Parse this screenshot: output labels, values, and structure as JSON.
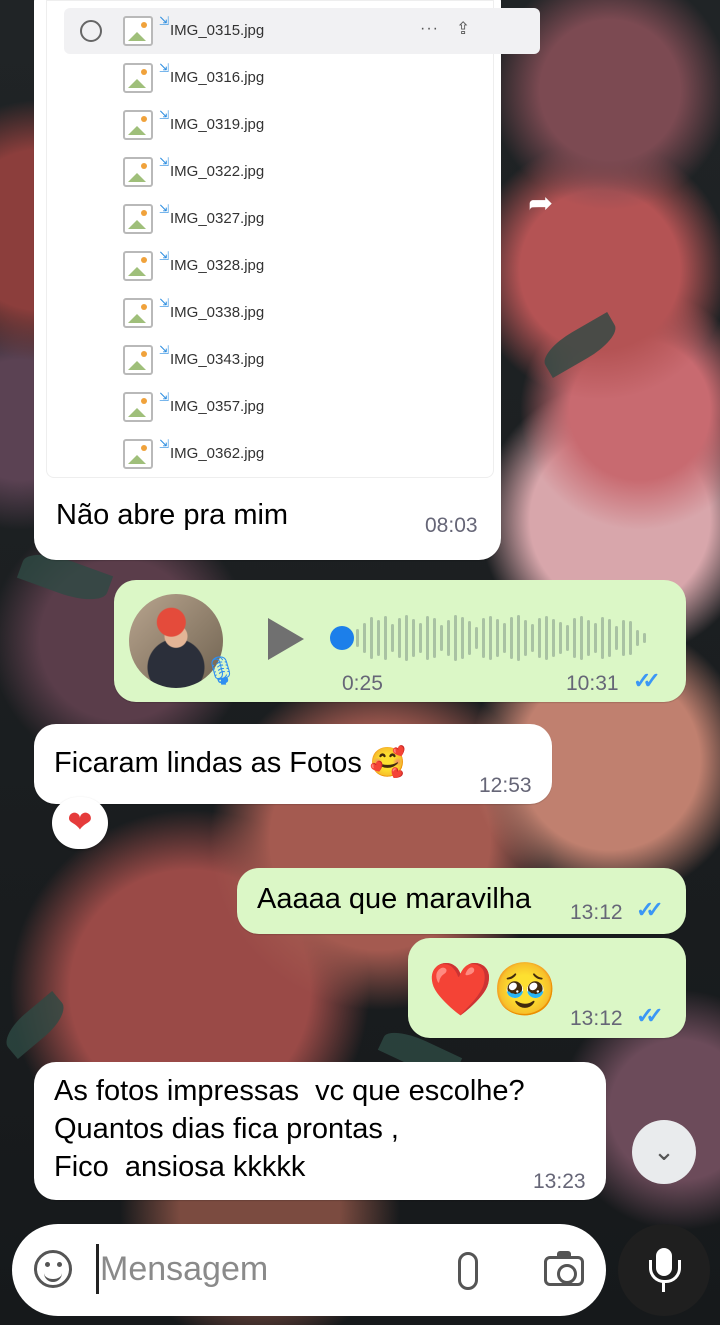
{
  "files": [
    {
      "name": "IMG_0315.jpg",
      "selected": true
    },
    {
      "name": "IMG_0316.jpg"
    },
    {
      "name": "IMG_0319.jpg"
    },
    {
      "name": "IMG_0322.jpg"
    },
    {
      "name": "IMG_0327.jpg"
    },
    {
      "name": "IMG_0328.jpg"
    },
    {
      "name": "IMG_0338.jpg"
    },
    {
      "name": "IMG_0343.jpg"
    },
    {
      "name": "IMG_0357.jpg"
    },
    {
      "name": "IMG_0362.jpg"
    }
  ],
  "messages": {
    "m1": {
      "text": "Não abre pra mim",
      "time": "08:03"
    },
    "voice": {
      "duration": "0:25",
      "time": "10:31"
    },
    "m2": {
      "text": "Ficaram lindas as Fotos 🥰",
      "time": "12:53",
      "reaction": "❤"
    },
    "m3": {
      "text": "Aaaaa que maravilha",
      "time": "13:12"
    },
    "m4": {
      "text": "❤️🥹",
      "time": "13:12"
    },
    "m5": {
      "text": "As fotos impressas  vc que escolhe?\nQuantos dias fica prontas ,\nFico  ansiosa kkkkk",
      "time": "13:23"
    }
  },
  "input": {
    "placeholder": "Mensagem"
  },
  "colors": {
    "outgoing": "#dbf7c6",
    "incoming": "#ffffff",
    "ticks": "#3b97f5"
  }
}
